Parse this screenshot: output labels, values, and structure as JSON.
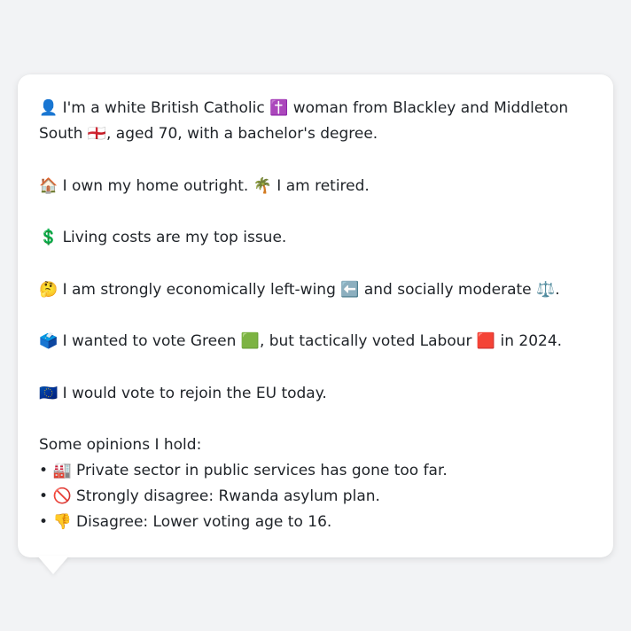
{
  "profile": {
    "identity": {
      "icon": "👤",
      "text_a": "I'm a white British Catholic",
      "icon_religion": "✝️",
      "text_b": "woman from Blackley and Middleton South",
      "icon_flag": "🏴󠁧󠁢󠁥󠁮󠁧󠁿",
      "text_c": ", aged 70, with a bachelor's degree."
    },
    "home": {
      "icon": "🏠",
      "text_a": "I own my home outright.",
      "icon_retired": "🌴",
      "text_b": "I am retired."
    },
    "issue": {
      "icon": "💲",
      "text": "Living costs are my top issue."
    },
    "politics": {
      "icon": "🤔",
      "text_a": "I am strongly economically left-wing",
      "icon_left": "⬅️",
      "text_b": "and socially moderate",
      "icon_moderate": "⚖️",
      "text_c": "."
    },
    "vote": {
      "icon": "🗳️",
      "text_a": "I wanted to vote Green",
      "icon_green": "🟩",
      "text_b": ", but tactically voted Labour",
      "icon_labour": "🟥",
      "text_c": "in 2024."
    },
    "eu": {
      "icon": "🇪🇺",
      "text": "I would vote to rejoin the EU today."
    },
    "opinions": {
      "heading": "Some opinions I hold:",
      "bullet": "•",
      "items": [
        {
          "icon": "🏭",
          "text": "Private sector in public services has gone too far."
        },
        {
          "icon": "🚫",
          "text": "Strongly disagree: Rwanda asylum plan."
        },
        {
          "icon": "👎",
          "text": "Disagree: Lower voting age to 16."
        }
      ]
    }
  }
}
